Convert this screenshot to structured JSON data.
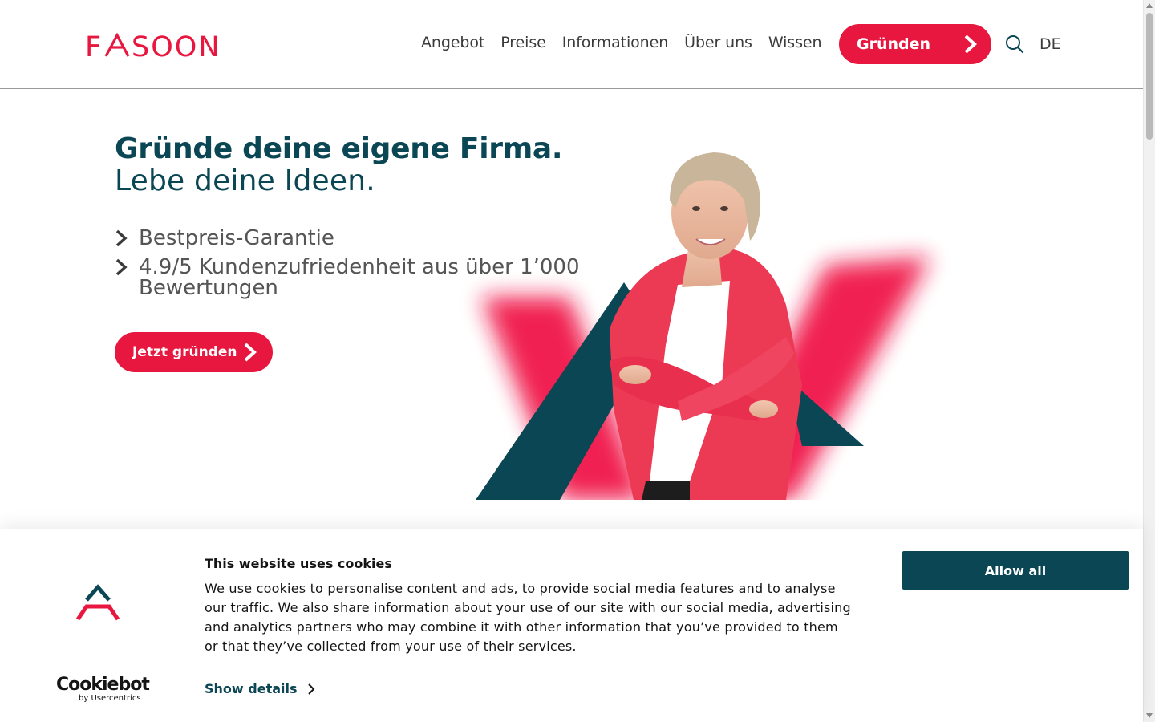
{
  "brand": {
    "name": "FASOON",
    "primary_color": "#e8173f",
    "dark_color": "#0b4654"
  },
  "nav": {
    "items": [
      {
        "label": "Angebot"
      },
      {
        "label": "Preise"
      },
      {
        "label": "Informationen"
      },
      {
        "label": "Über uns"
      },
      {
        "label": "Wissen"
      }
    ],
    "cta_label": "Gründen",
    "search_icon": "search-icon",
    "language": "DE"
  },
  "hero": {
    "title": "Gründe deine eigene Firma.",
    "subtitle": "Lebe deine Ideen.",
    "bullets": [
      "Bestpreis-Garantie",
      "4.9/5 Kundenzufriedenheit aus über 1’000 Bewertungen"
    ],
    "cta_label": "Jetzt gründen"
  },
  "cookie_banner": {
    "title": "This website uses cookies",
    "text": "We use cookies to personalise content and ads, to provide social media features and to analyse our traffic. We also share information about your use of our site with our social media, advertising and analytics partners who may combine it with other information that you’ve provided to them or that they’ve collected from your use of their services.",
    "show_details_label": "Show details",
    "allow_all_label": "Allow all",
    "provider_name": "Cookiebot",
    "provider_sub": "by Usercentrics"
  }
}
